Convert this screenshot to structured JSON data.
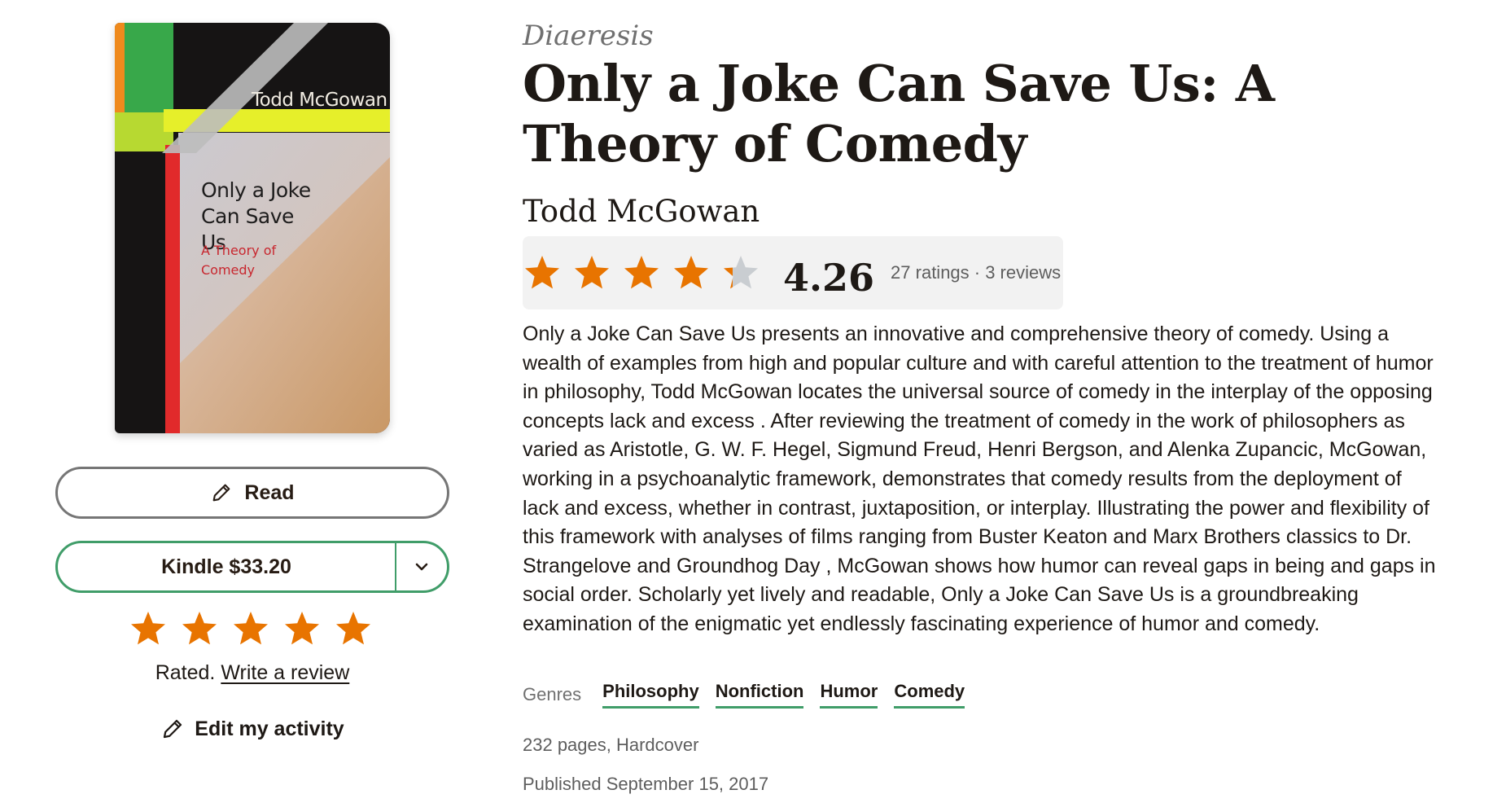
{
  "book": {
    "series": "Diaeresis",
    "title": "Only a Joke Can Save Us: A Theory of Comedy",
    "author": "Todd McGowan",
    "cover": {
      "author": "Todd McGowan",
      "title": "Only a Joke Can Save Us",
      "subtitle": "A Theory of Comedy"
    }
  },
  "actions": {
    "read_label": "Read",
    "kindle_label": "Kindle $33.20"
  },
  "user_rating": {
    "stars": 5,
    "max": 5,
    "rated_text": "Rated.",
    "write_review": "Write a review",
    "edit_activity": "Edit my activity"
  },
  "rating": {
    "average": "4.26",
    "average_value": 4.26,
    "meta": "27 ratings · 3 reviews"
  },
  "description": "Only a Joke Can Save Us presents an innovative and comprehensive theory of comedy. Using a wealth of examples from high and popular culture and with careful attention to the treatment of humor in philosophy, Todd McGowan locates the universal source of comedy in the interplay of the opposing concepts lack and excess . After reviewing the treatment of comedy in the work of philosophers as varied as Aristotle, G. W. F. Hegel, Sigmund Freud, Henri Bergson, and Alenka Zupancic, McGowan, working in a psychoanalytic framework, demonstrates that comedy results from the deployment of lack and excess, whether in contrast, juxtaposition, or interplay. Illustrating the power and flexibility of this framework with analyses of films ranging from Buster Keaton and Marx Brothers classics to Dr. Strangelove and Groundhog Day , McGowan shows how humor can reveal gaps in being and gaps in social order. Scholarly yet lively and readable, Only a Joke Can Save Us is a groundbreaking examination of the enigmatic yet endlessly fascinating experience of humor and comedy.",
  "genres": {
    "label": "Genres",
    "items": [
      "Philosophy",
      "Nonfiction",
      "Humor",
      "Comedy"
    ]
  },
  "details": {
    "format": "232 pages, Hardcover",
    "published": "Published September 15, 2017"
  },
  "colors": {
    "star_filled": "#e87400",
    "star_empty": "#c9cdd1",
    "accent_green": "#409d69",
    "text": "#1e1915"
  }
}
